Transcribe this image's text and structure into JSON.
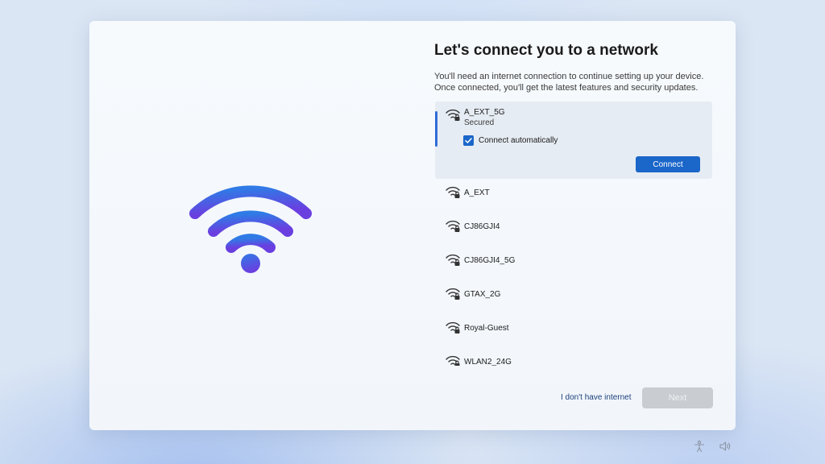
{
  "page": {
    "title": "Let's connect you to a network",
    "subtitle": "You'll need an internet connection to continue setting up your device. Once connected, you'll get the latest features and security updates."
  },
  "networks": {
    "selected": {
      "name": "A_EXT_5G",
      "status": "Secured",
      "connect_automatically_label": "Connect automatically",
      "connect_automatically_checked": true,
      "connect_label": "Connect"
    },
    "others": [
      {
        "name": "A_EXT"
      },
      {
        "name": "CJ86GJI4"
      },
      {
        "name": "CJ86GJI4_5G"
      },
      {
        "name": "GTAX_2G"
      },
      {
        "name": "Royal-Guest"
      },
      {
        "name": "WLAN2_24G"
      }
    ]
  },
  "footer": {
    "no_internet_label": "I don't have internet",
    "next_label": "Next"
  },
  "tray": {
    "icons": [
      "accessibility-icon",
      "volume-icon"
    ]
  },
  "colors": {
    "accent": "#1b66c9",
    "wifi_gradient_start": "#2f7be6",
    "wifi_gradient_end": "#6a3fe0",
    "next_disabled": "#c9ccd0"
  }
}
